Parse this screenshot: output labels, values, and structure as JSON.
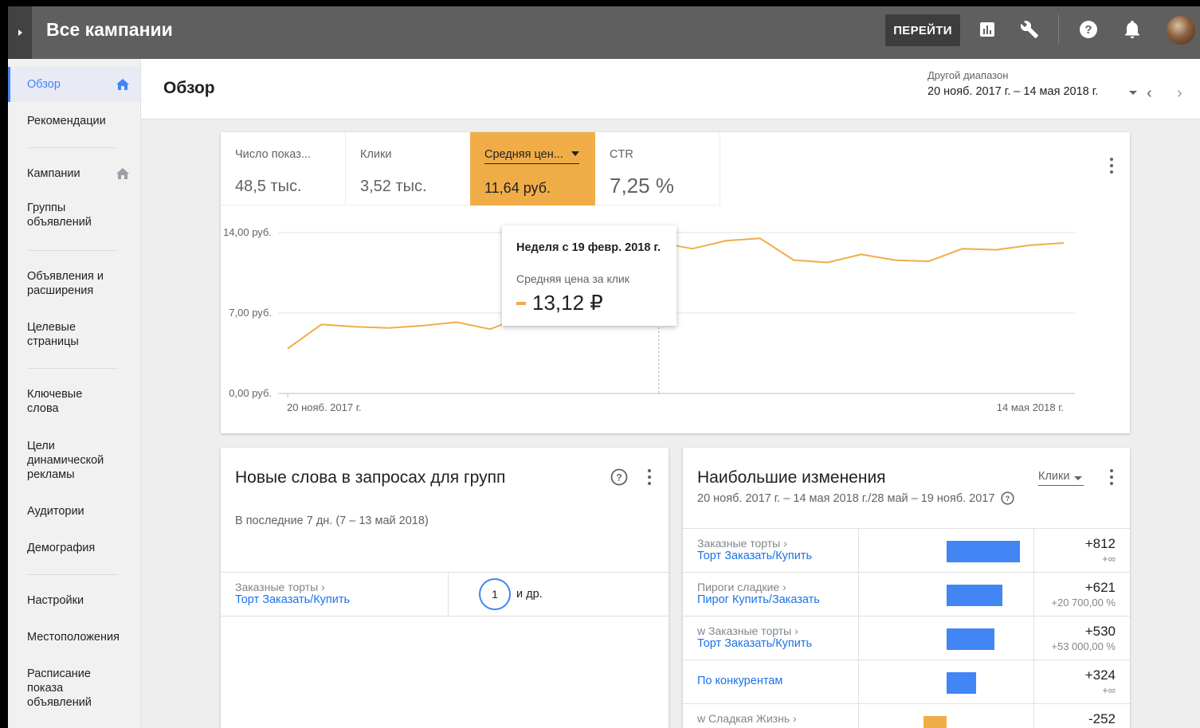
{
  "header": {
    "title": "Все кампании",
    "goto_label": "ПЕРЕЙТИ"
  },
  "sidebar": {
    "items": [
      {
        "label": "Обзор"
      },
      {
        "label": "Рекомендации"
      },
      {
        "label": "Кампании"
      },
      {
        "label": "Группы объявлений"
      },
      {
        "label": "Объявления и расширения"
      },
      {
        "label": "Целевые страницы"
      },
      {
        "label": "Ключевые слова"
      },
      {
        "label": "Цели динамической рекламы"
      },
      {
        "label": "Аудитории"
      },
      {
        "label": "Демография"
      },
      {
        "label": "Настройки"
      },
      {
        "label": "Местоположения"
      },
      {
        "label": "Расписание показа объявлений"
      }
    ]
  },
  "page": {
    "title": "Обзор",
    "date_range_label": "Другой диапазон",
    "date_range_value": "20 нояб. 2017 г. – 14 мая 2018 г."
  },
  "metrics": [
    {
      "label": "Число показ...",
      "value": "48,5 тыс."
    },
    {
      "label": "Клики",
      "value": "3,52 тыс."
    },
    {
      "label": "Средняя цен...",
      "value": "11,64 руб."
    },
    {
      "label": "CTR",
      "value": "7,25 %"
    }
  ],
  "colors": {
    "accent": "#f0ad47",
    "link": "#1a73e8",
    "bar": "#4285f4",
    "bar_negative": "#f0ad47",
    "header_bg": "#5f5f5f"
  },
  "chart_data": {
    "type": "line",
    "x_labels": [
      "20 нояб. 2017 г.",
      "14 мая 2018 г."
    ],
    "y_ticks": [
      "0,00 руб.",
      "7,00 руб.",
      "14,00 руб."
    ],
    "ylim": [
      0,
      14
    ],
    "series": [
      {
        "values": [
          3.9,
          6.0,
          5.8,
          5.7,
          5.9,
          6.2,
          5.6,
          6.7,
          7.6,
          6.0,
          9.9,
          13.12,
          12.6,
          13.3,
          13.5,
          11.6,
          11.4,
          12.1,
          11.6,
          11.5,
          12.6,
          12.5,
          12.9,
          13.1
        ]
      }
    ],
    "x_labels_on_axis": [
      "20 нояб. 2017 г.",
      "14 мая 2018 г."
    ],
    "highlight_index": 11
  },
  "tooltip": {
    "title": "Неделя с 19 февр. 2018 г.",
    "metric": "Средняя цена за клик",
    "value": "13,12 ₽"
  },
  "search_terms": {
    "title": "Новые слова в запросах для групп",
    "subtitle": "В последние 7 дн. (7 – 13 май 2018)",
    "row": {
      "category": "Заказные торты ›",
      "link": "Торт Заказать/Купить",
      "count": "1",
      "more": "и др."
    }
  },
  "biggest_changes": {
    "title": "Наибольшие изменения",
    "sort_label": "Клики",
    "subtitle": "20 нояб. 2017 г. – 14 мая 2018 г./28 май – 19 нояб. 2017",
    "rows": [
      {
        "category": "Заказные торты ›",
        "link": "Торт Заказать/Купить",
        "value": "+812",
        "pct": "+∞",
        "amount": 812
      },
      {
        "category": "Пироги сладкие ›",
        "link": "Пирог Купить/Заказать",
        "value": "+621",
        "pct": "+20 700,00 %",
        "amount": 621
      },
      {
        "category": "w Заказные торты ›",
        "link": "Торт Заказать/Купить",
        "value": "+530",
        "pct": "+53 000,00 %",
        "amount": 530
      },
      {
        "category": "",
        "link": "По конкурентам",
        "value": "+324",
        "pct": "+∞",
        "amount": 324
      },
      {
        "category": "w Сладкая Жизнь ›",
        "link": "",
        "value": "-252",
        "pct": "",
        "amount": -252
      }
    ]
  }
}
